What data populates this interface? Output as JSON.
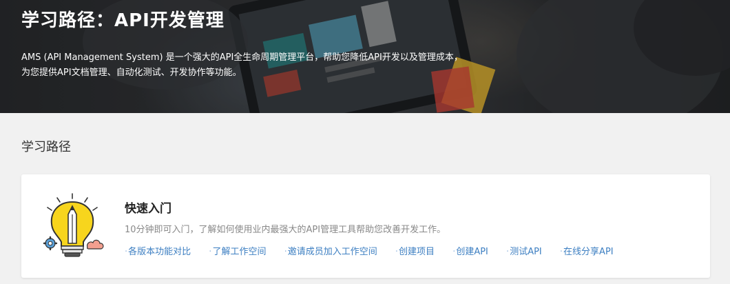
{
  "hero": {
    "title": "学习路径：API开发管理",
    "desc_line1": "AMS (API Management System) 是一个强大的API全生命周期管理平台，帮助您降低API开发以及管理成本，",
    "desc_line2": "为您提供API文档管理、自动化测试、开发协作等功能。"
  },
  "section": {
    "title": "学习路径"
  },
  "card": {
    "icon": "lightbulb-pencil-icon",
    "title": "快速入门",
    "desc": "10分钟即可入门，了解如何使用业内最强大的API管理工具帮助您改善开发工作。",
    "links": [
      "各版本功能对比",
      "了解工作空间",
      "邀请成员加入工作空间",
      "创建项目",
      "创建API",
      "测试API",
      "在线分享API"
    ]
  },
  "colors": {
    "link": "#3d7fc2",
    "bulb": "#f7d51d",
    "hero_bg": "#2f3134"
  }
}
